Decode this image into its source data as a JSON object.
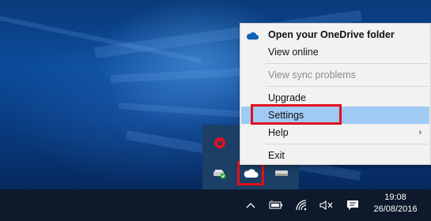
{
  "context_menu": {
    "items": [
      {
        "label": "Open your OneDrive folder",
        "style": "bold",
        "icon": "onedrive-cloud-icon"
      },
      {
        "label": "View online"
      },
      {
        "label": "View sync problems",
        "disabled": true
      },
      {
        "label": "Upgrade"
      },
      {
        "label": "Settings",
        "hovered": true
      },
      {
        "label": "Help",
        "submenu": true
      },
      {
        "label": "Exit"
      }
    ],
    "submenu_arrow": "›"
  },
  "tray_overflow": {
    "icons": [
      "beats-audio-icon",
      "safely-remove-hardware-icon",
      "onedrive-cloud-icon",
      "storage-drive-icon"
    ]
  },
  "system_tray": {
    "icons": [
      "show-hidden-icons-chevron",
      "battery-icon",
      "wifi-icon",
      "volume-muted-icon",
      "action-center-icon"
    ]
  },
  "clock": {
    "time": "19:08",
    "date": "26/08/2016"
  },
  "colors": {
    "highlight_box": "#e0101c",
    "menu_hover": "#9fcaf3",
    "taskbar": "#0e1a2b"
  }
}
